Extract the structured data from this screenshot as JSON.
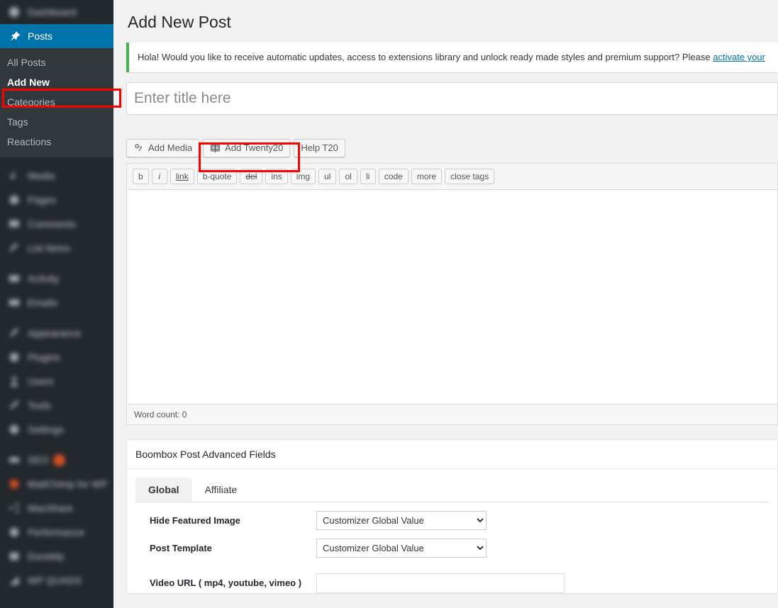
{
  "sidebar": {
    "items": [
      {
        "label": "Dashboard",
        "icon": "dashboard-icon",
        "state": "blurred"
      },
      {
        "label": "Posts",
        "icon": "pin-icon",
        "state": "current"
      },
      {
        "label": "Media",
        "icon": "media-icon",
        "state": "blurred"
      },
      {
        "label": "Pages",
        "icon": "page-icon",
        "state": "blurred"
      },
      {
        "label": "Comments",
        "icon": "comments-icon",
        "state": "blurred"
      },
      {
        "label": "List Items",
        "icon": "pencil-icon",
        "state": "blurred"
      },
      {
        "label": "Activity",
        "icon": "activity-icon",
        "state": "blurred"
      },
      {
        "label": "Emails",
        "icon": "email-icon",
        "state": "blurred"
      },
      {
        "label": "Appearance",
        "icon": "brush-icon",
        "state": "blurred"
      },
      {
        "label": "Plugins",
        "icon": "plugin-icon",
        "state": "blurred"
      },
      {
        "label": "Users",
        "icon": "users-icon",
        "state": "blurred"
      },
      {
        "label": "Tools",
        "icon": "tools-icon",
        "state": "blurred"
      },
      {
        "label": "Settings",
        "icon": "settings-icon",
        "state": "blurred"
      },
      {
        "label": "SEO",
        "icon": "seo-icon",
        "state": "blurred",
        "badge": "1"
      },
      {
        "label": "MailChimp for WP",
        "icon": "mailchimp-icon",
        "state": "blurred"
      },
      {
        "label": "MaxShare",
        "icon": "share-icon",
        "state": "blurred"
      },
      {
        "label": "Performance",
        "icon": "performance-icon",
        "state": "blurred"
      },
      {
        "label": "Dunebly",
        "icon": "dunebly-icon",
        "state": "blurred"
      },
      {
        "label": "WP QUADS",
        "icon": "quads-icon",
        "state": "blurred"
      }
    ],
    "submenu": [
      {
        "label": "All Posts",
        "active": false
      },
      {
        "label": "Add New",
        "active": true
      },
      {
        "label": "Categories",
        "active": false
      },
      {
        "label": "Tags",
        "active": false
      },
      {
        "label": "Reactions",
        "active": false
      }
    ]
  },
  "header": {
    "page_title": "Add New Post"
  },
  "notice": {
    "text": "Hola! Would you like to receive automatic updates, access to extensions library and unlock ready made styles and premium support? Please ",
    "link_text": "activate your ",
    "accent_color": "#46b450"
  },
  "title_field": {
    "value": "",
    "placeholder": "Enter title here"
  },
  "media_buttons": [
    {
      "label": "Add Media",
      "icon": "add-media-icon"
    },
    {
      "label": "Add Twenty20",
      "icon": "twenty20-icon"
    },
    {
      "label": "Help T20",
      "icon": ""
    }
  ],
  "quicktags": [
    {
      "label": "b",
      "style": "bold"
    },
    {
      "label": "i",
      "style": "italic"
    },
    {
      "label": "link",
      "style": "link"
    },
    {
      "label": "b-quote",
      "style": ""
    },
    {
      "label": "del",
      "style": "del"
    },
    {
      "label": "ins",
      "style": ""
    },
    {
      "label": "img",
      "style": ""
    },
    {
      "label": "ul",
      "style": ""
    },
    {
      "label": "ol",
      "style": ""
    },
    {
      "label": "li",
      "style": ""
    },
    {
      "label": "code",
      "style": ""
    },
    {
      "label": "more",
      "style": ""
    },
    {
      "label": "close tags",
      "style": ""
    }
  ],
  "editor": {
    "content": "",
    "word_count_label": "Word count: 0"
  },
  "metabox": {
    "title": "Boombox Post Advanced Fields",
    "tabs": [
      {
        "label": "Global",
        "active": true
      },
      {
        "label": "Affiliate",
        "active": false
      }
    ],
    "fields": [
      {
        "label": "Hide Featured Image",
        "type": "select",
        "value": "Customizer Global Value"
      },
      {
        "label": "Post Template",
        "type": "select",
        "value": "Customizer Global Value"
      },
      {
        "label": "Video URL ( mp4, youtube, vimeo )",
        "type": "text",
        "value": ""
      }
    ]
  },
  "annotations": {
    "color": "#ff0000",
    "boxes": [
      {
        "name": "add-new-highlight",
        "target": "Add New"
      },
      {
        "name": "add-twenty20-highlight",
        "target": "Add Twenty20"
      }
    ]
  }
}
